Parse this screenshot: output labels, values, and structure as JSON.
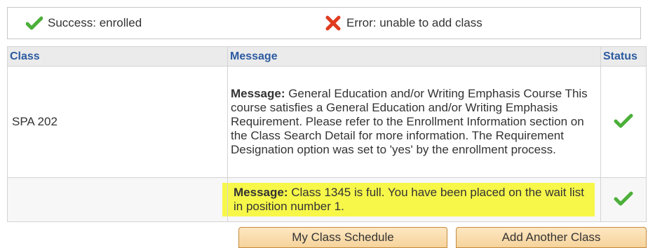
{
  "legend": {
    "success_label": "Success: enrolled",
    "error_label": "Error: unable to add class"
  },
  "table": {
    "headers": [
      "Class",
      "Message",
      "Status"
    ],
    "rows": [
      {
        "class": "SPA  202",
        "message_label": "Message:",
        "message_text": " General Education and/or Writing Emphasis Course This course satisfies a General Education and/or Writing Emphasis Requirement. Please refer to the Enrollment Information section on the Class Search Detail for more information. The Requirement Designation option was set to 'yes' by the enrollment process.",
        "status": "success"
      },
      {
        "class": "",
        "message_label": "Message:",
        "message_text": " Class 1345 is full. You have been placed on the wait list in position number 1.",
        "status": "success"
      }
    ]
  },
  "buttons": {
    "schedule_label": "My Class Schedule",
    "add_label": "Add Another Class"
  },
  "colors": {
    "success_check": "#4caf3a",
    "error_x": "#e03b1f",
    "header_text": "#2c5aa0",
    "highlight": "#f7f74a"
  }
}
